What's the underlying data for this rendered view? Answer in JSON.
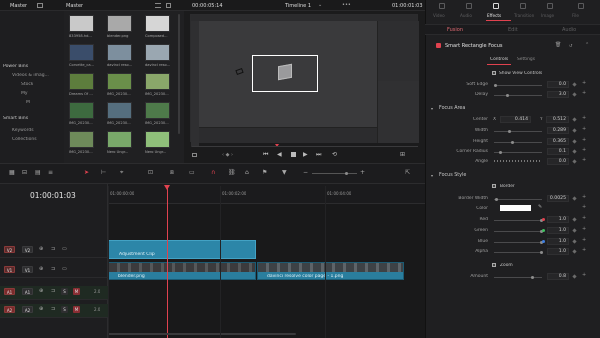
{
  "header": {
    "master_left": "Master",
    "master_pool": "Master",
    "source_timecode": "00:00:05:14",
    "timeline_name": "Timeline 1",
    "record_timecode": "01:00:01:03"
  },
  "bins": {
    "power_bins_title": "Power Bins",
    "power_items": [
      "Videos & imag...",
      "Stock",
      "My",
      "M"
    ],
    "smart_bins_title": "Smart Bins",
    "smart_items": [
      "Keywords",
      "Collections"
    ]
  },
  "media_pool": {
    "clips": [
      {
        "name": "833958.hd...",
        "color": "#c9c9c9"
      },
      {
        "name": "blender.png",
        "color": "#a9a9a9"
      },
      {
        "name": "Composed...",
        "color": "#d6d6d6"
      },
      {
        "name": "Corvette_ca...",
        "color": "#3a4d6a"
      },
      {
        "name": "davinci reso...",
        "color": "#7d8f9e"
      },
      {
        "name": "davinci reso...",
        "color": "#9aa7b1"
      },
      {
        "name": "Dreams Of ...",
        "color": "#5d7d3d"
      },
      {
        "name": "IMG_20230...",
        "color": "#6a8f4a"
      },
      {
        "name": "IMG_20230...",
        "color": "#8aa76a"
      },
      {
        "name": "IMG_20230...",
        "color": "#3d6a3f"
      },
      {
        "name": "IMG_20230...",
        "color": "#556e7e"
      },
      {
        "name": "IMG_20230...",
        "color": "#4e7a4a"
      },
      {
        "name": "IMG_20230...",
        "color": "#6e8a5a"
      },
      {
        "name": "Nero Ungr...",
        "color": "#79a86a"
      },
      {
        "name": "Nero Ungr...",
        "color": "#8fbf7a"
      }
    ]
  },
  "inspector": {
    "top_tabs": [
      "Video",
      "Audio",
      "Effects",
      "Transition",
      "Image",
      "File"
    ],
    "active_top_tab": "Effects",
    "sub_tabs": [
      "Fusion",
      "Edit",
      "Audio"
    ],
    "active_sub_tab": "Fusion",
    "effect_name": "Smart Rectangle Focus",
    "panel_tabs": [
      "Controls",
      "Settings"
    ],
    "show_view_controls_label": "Show View Controls",
    "soft_edge": {
      "label": "Soft Edge",
      "value": "0.0"
    },
    "delay": {
      "label": "Delay",
      "value": "3.0"
    },
    "focus_area_title": "Focus Area",
    "center": {
      "label": "Center",
      "x_label": "X",
      "x": "0.414",
      "y_label": "Y",
      "y": "0.512"
    },
    "width": {
      "label": "Width",
      "value": "0.289"
    },
    "height": {
      "label": "Height",
      "value": "0.365"
    },
    "corner_radius": {
      "label": "Corner Radius",
      "value": "0.1"
    },
    "angle": {
      "label": "Angle",
      "value": "0.0"
    },
    "focus_style_title": "Focus Style",
    "border_label": "Border",
    "border_width": {
      "label": "Border Width",
      "value": "0.0025"
    },
    "color_label": "Color",
    "red": {
      "label": "Red",
      "value": "1.0"
    },
    "green": {
      "label": "Green",
      "value": "1.0"
    },
    "blue": {
      "label": "Blue",
      "value": "1.0"
    },
    "alpha": {
      "label": "Alpha",
      "value": "1.0"
    },
    "zoom_label": "Zoom",
    "amount": {
      "label": "Amount",
      "value": "0.8"
    }
  },
  "timeline": {
    "timecode": "01:00:01:03",
    "ruler": [
      "01:00:00:00",
      "01:00:02:00",
      "01:00:04:00"
    ],
    "tracks": [
      {
        "id": "V2",
        "label": "V2"
      },
      {
        "id": "V1",
        "label": "V1"
      },
      {
        "id": "A1",
        "label": "A1",
        "level": "2.0"
      },
      {
        "id": "A2",
        "label": "A2",
        "level": "2.0"
      }
    ],
    "clips": {
      "adjustment": "Adjustment Clip",
      "v1_a": "blender.png",
      "v1_b": "davinci resolve color page - 1.png"
    }
  },
  "colors": {
    "accent": "#e0424f",
    "clip_blue": "#2a7e9e",
    "adj_clip": "#2c86a8"
  }
}
